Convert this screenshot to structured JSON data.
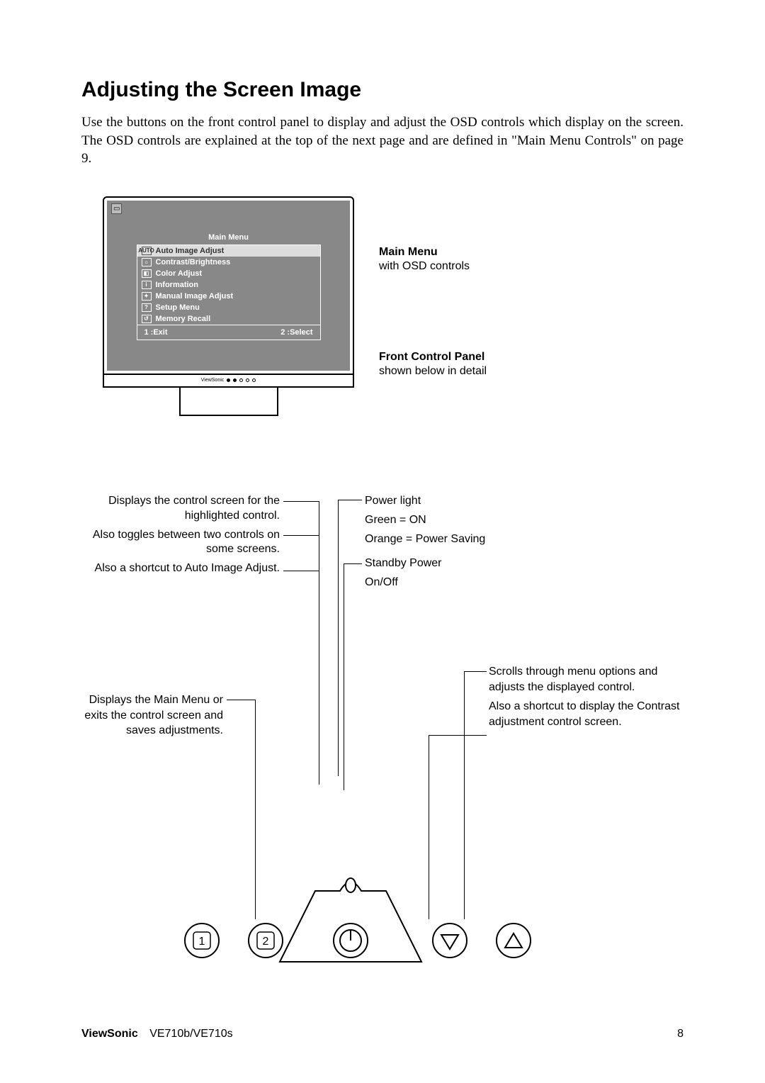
{
  "heading": "Adjusting the Screen Image",
  "intro": "Use the buttons on the front control panel to display and adjust the OSD controls which display on the screen. The OSD controls are explained at the top of the next page and are defined in \"Main Menu Controls\" on page 9.",
  "osd": {
    "title": "Main Menu",
    "items": [
      {
        "icon": "AUTO",
        "label": "Auto Image Adjust",
        "selected": true
      },
      {
        "icon": "☼",
        "label": "Contrast/Brightness"
      },
      {
        "icon": "◧",
        "label": "Color Adjust"
      },
      {
        "icon": "i",
        "label": "Information"
      },
      {
        "icon": "✦",
        "label": "Manual Image Adjust"
      },
      {
        "icon": "?",
        "label": "Setup Menu"
      },
      {
        "icon": "↺",
        "label": "Memory Recall"
      }
    ],
    "footer_left": "1 :Exit",
    "footer_right": "2 :Select",
    "stand_label": "ViewSonic"
  },
  "side": {
    "main_title": "Main Menu",
    "main_sub": "with OSD controls",
    "panel_title": "Front Control Panel",
    "panel_sub": "shown below in detail"
  },
  "callouts": {
    "left1": "Displays the control screen for the highlighted control.",
    "left2": "Also toggles between two controls on some screens.",
    "left3": "Also a shortcut to Auto Image Adjust.",
    "right1a": "Power light",
    "right1b": "Green = ON",
    "right1c": "Orange = Power Saving",
    "right2a": "Standby Power",
    "right2b": "On/Off"
  },
  "panel": {
    "left1": "Displays the Main Menu or exits the control screen and saves adjustments.",
    "right1": "Scrolls through menu options and adjusts the displayed control.",
    "right2": "Also a shortcut to display the Contrast adjustment control screen."
  },
  "buttons": {
    "b1": "1",
    "b2": "2"
  },
  "footer": {
    "brand": "ViewSonic",
    "model": "VE710b/VE710s",
    "page": "8"
  }
}
